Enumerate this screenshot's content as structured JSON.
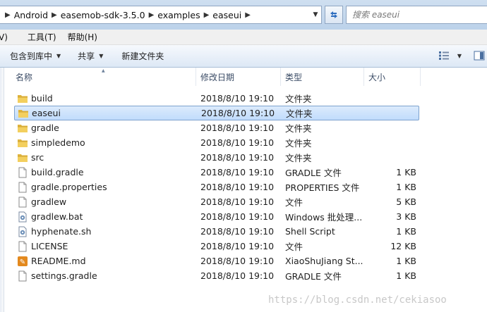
{
  "address": {
    "crumbs": [
      "Android",
      "easemob-sdk-3.5.0",
      "examples",
      "easeui"
    ]
  },
  "search": {
    "placeholder": "搜索 easeui"
  },
  "menu": {
    "items": [
      "V)",
      "工具(T)",
      "帮助(H)"
    ]
  },
  "toolbar": {
    "include_library": "包含到库中",
    "share": "共享",
    "new_folder": "新建文件夹"
  },
  "columns": {
    "name": "名称",
    "date": "修改日期",
    "type": "类型",
    "size": "大小"
  },
  "files": [
    {
      "name": "build",
      "date": "2018/8/10 19:10",
      "type": "文件夹",
      "size": "",
      "icon": "folder-icon"
    },
    {
      "name": "easeui",
      "date": "2018/8/10 19:10",
      "type": "文件夹",
      "size": "",
      "icon": "folder-icon"
    },
    {
      "name": "gradle",
      "date": "2018/8/10 19:10",
      "type": "文件夹",
      "size": "",
      "icon": "folder-icon"
    },
    {
      "name": "simpledemo",
      "date": "2018/8/10 19:10",
      "type": "文件夹",
      "size": "",
      "icon": "folder-icon"
    },
    {
      "name": "src",
      "date": "2018/8/10 19:10",
      "type": "文件夹",
      "size": "",
      "icon": "folder-icon"
    },
    {
      "name": "build.gradle",
      "date": "2018/8/10 19:10",
      "type": "GRADLE 文件",
      "size": "1 KB",
      "icon": "file-icon"
    },
    {
      "name": "gradle.properties",
      "date": "2018/8/10 19:10",
      "type": "PROPERTIES 文件",
      "size": "1 KB",
      "icon": "file-icon"
    },
    {
      "name": "gradlew",
      "date": "2018/8/10 19:10",
      "type": "文件",
      "size": "5 KB",
      "icon": "file-icon"
    },
    {
      "name": "gradlew.bat",
      "date": "2018/8/10 19:10",
      "type": "Windows 批处理...",
      "size": "3 KB",
      "icon": "gear-file-icon"
    },
    {
      "name": "hyphenate.sh",
      "date": "2018/8/10 19:10",
      "type": "Shell Script",
      "size": "1 KB",
      "icon": "gear-file-icon"
    },
    {
      "name": "LICENSE",
      "date": "2018/8/10 19:10",
      "type": "文件",
      "size": "12 KB",
      "icon": "file-icon"
    },
    {
      "name": "README.md",
      "date": "2018/8/10 19:10",
      "type": "XiaoShuJiang St...",
      "size": "1 KB",
      "icon": "app-file-icon"
    },
    {
      "name": "settings.gradle",
      "date": "2018/8/10 19:10",
      "type": "GRADLE 文件",
      "size": "1 KB",
      "icon": "file-icon"
    }
  ],
  "selected_index": 1,
  "watermark": "https://blog.csdn.net/cekiasoo"
}
